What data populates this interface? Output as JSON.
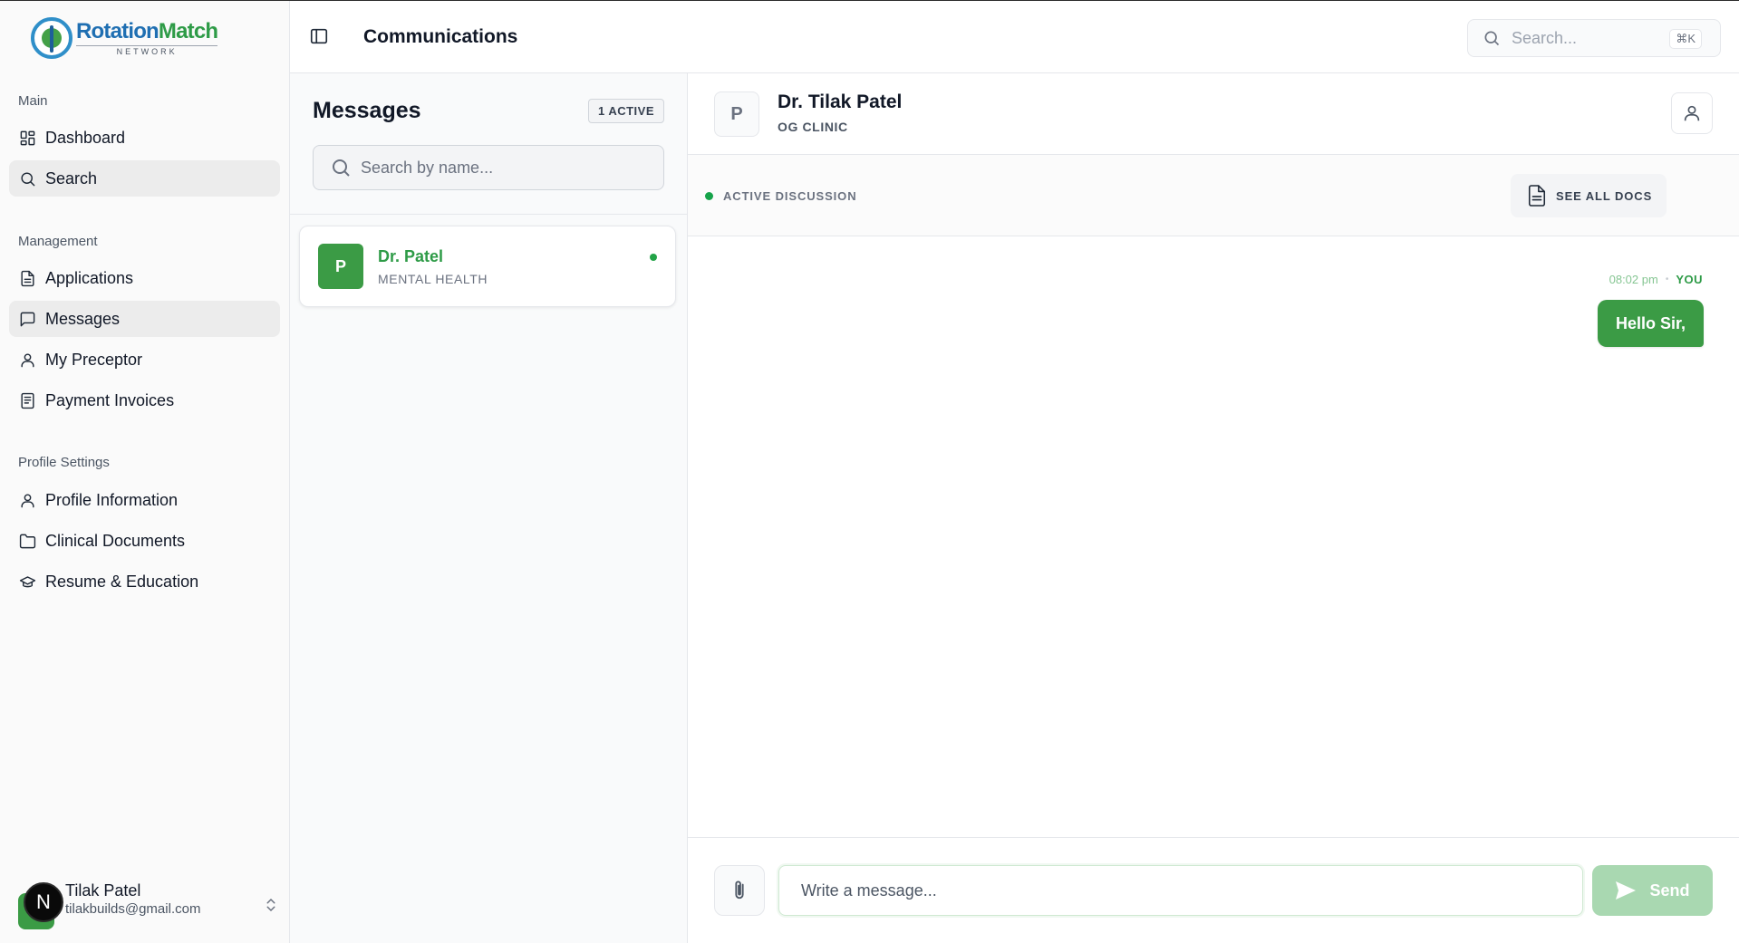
{
  "app": {
    "logo_part1": "Rotation",
    "logo_part2": "Match",
    "logo_sub": "NETWORK"
  },
  "sidebar": {
    "sections": [
      {
        "label": "Main",
        "items": [
          {
            "label": "Dashboard",
            "icon": "dashboard-icon"
          },
          {
            "label": "Search",
            "icon": "search-icon",
            "active": true
          }
        ]
      },
      {
        "label": "Management",
        "items": [
          {
            "label": "Applications",
            "icon": "document-icon"
          },
          {
            "label": "Messages",
            "icon": "message-icon",
            "active": true
          },
          {
            "label": "My Preceptor",
            "icon": "user-icon"
          },
          {
            "label": "Payment Invoices",
            "icon": "invoice-icon"
          }
        ]
      },
      {
        "label": "Profile Settings",
        "items": [
          {
            "label": "Profile Information",
            "icon": "user-icon"
          },
          {
            "label": "Clinical Documents",
            "icon": "folder-icon"
          },
          {
            "label": "Resume & Education",
            "icon": "graduation-cap-icon"
          }
        ]
      }
    ],
    "user": {
      "initial": "N",
      "name": "Tilak Patel",
      "email": "tilakbuilds@gmail.com"
    }
  },
  "header": {
    "title": "Communications",
    "search_placeholder": "Search...",
    "shortcut": "⌘K"
  },
  "messages_list": {
    "title": "Messages",
    "badge": "1 ACTIVE",
    "search_placeholder": "Search by name...",
    "contacts": [
      {
        "initial": "P",
        "name": "Dr. Patel",
        "department": "MENTAL HEALTH",
        "online": true
      }
    ]
  },
  "chat": {
    "avatar_initial": "P",
    "name": "Dr. Tilak Patel",
    "clinic": "OG CLINIC",
    "status": "ACTIVE DISCUSSION",
    "docs_button": "SEE ALL DOCS",
    "messages": [
      {
        "time": "08:02 pm",
        "separator": "•",
        "sender": "YOU",
        "text": "Hello Sir,"
      }
    ],
    "composer_placeholder": "Write a message...",
    "send_label": "Send"
  },
  "colors": {
    "brand_green": "#3b9b45",
    "brand_blue": "#1f6fb2",
    "send_disabled": "#a9d8b1"
  }
}
